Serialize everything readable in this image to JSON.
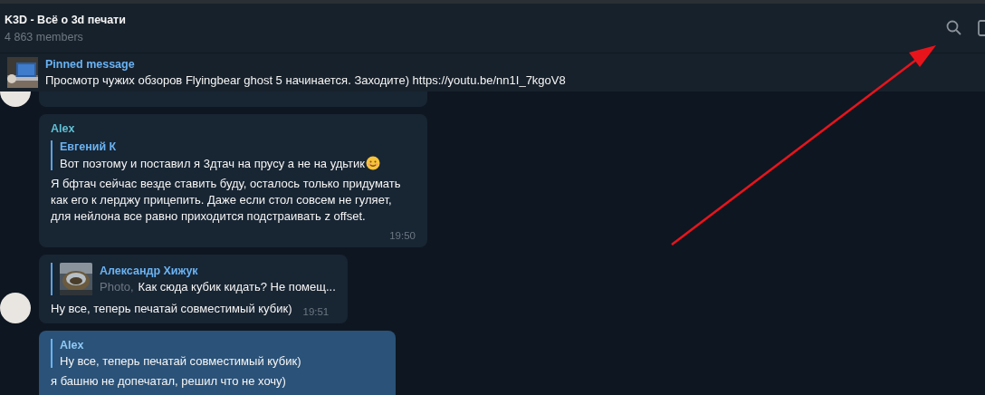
{
  "header": {
    "title": "K3D - Всё о 3d печати",
    "subtitle": "4 863 members"
  },
  "pinned": {
    "label": "Pinned message",
    "text": "Просмотр чужих обзоров Flyingbear ghost 5 начинается. Заходите) https://youtu.be/nn1I_7kgoV8"
  },
  "messages": [
    {
      "kind": "partial",
      "avatar": true
    },
    {
      "kind": "incoming",
      "author": "Alex",
      "reply": {
        "author": "Евгений К",
        "text": "Вот поэтому и поставил я 3дтач на прусу а не на удьтик",
        "emoji": true
      },
      "text": "Я бфтач сейчас везде ставить буду, осталось только придумать как его к лерджу прицепить. Даже если стол совсем не гуляет, для нейлона все равно приходится подстраивать z offset.",
      "time": "19:50",
      "avatar": false
    },
    {
      "kind": "incoming",
      "reply": {
        "author": "Александр Хижук",
        "prefix": "Photo,",
        "text": "Как сюда кубик кидать? Не помещ...",
        "thumbnail": true
      },
      "text": "Ну все, теперь печатай совместимый кубик)",
      "time": "19:51",
      "avatar": true
    },
    {
      "kind": "outgoing",
      "reply": {
        "author": "Alex",
        "text": "Ну все, теперь печатай совместимый кубик)"
      },
      "text": "я башню не допечатал, решил что не хочу)",
      "avatar": false
    }
  ],
  "annotation": {
    "kind": "arrow"
  }
}
